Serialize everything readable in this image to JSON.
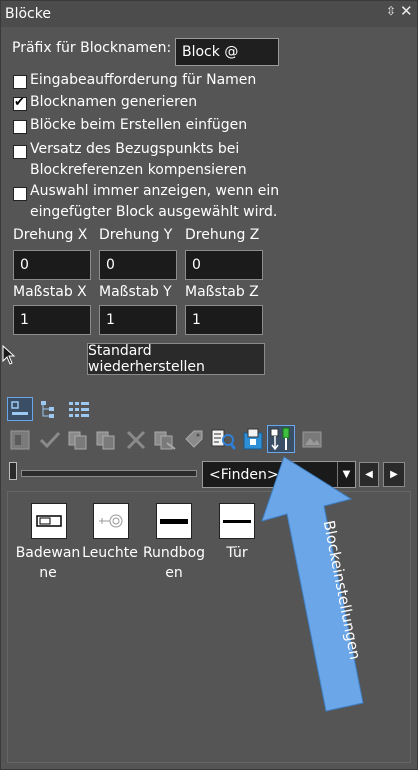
{
  "window": {
    "title": "Blöcke"
  },
  "prefix": {
    "label": "Präfix für Blocknamen:",
    "value": "Block @"
  },
  "options": [
    {
      "label": "Eingabeaufforderung für Namen",
      "checked": false
    },
    {
      "label": "Blocknamen generieren",
      "checked": true
    },
    {
      "label": "Blöcke beim Erstellen einfügen",
      "checked": false
    },
    {
      "label_line1": "Versatz des Bezugspunkts bei",
      "label_line2": "Blockreferenzen kompensieren",
      "checked": false
    },
    {
      "label_line1": "Auswahl immer anzeigen, wenn ein",
      "label_line2": "eingefügter Block ausgewählt wird.",
      "checked": false
    }
  ],
  "rotation": {
    "labels": [
      "Drehung X",
      "Drehung Y",
      "Drehung Z"
    ],
    "values": [
      "0",
      "0",
      "0"
    ]
  },
  "scale": {
    "labels": [
      "Maßstab X",
      "Maßstab Y",
      "Maßstab Z"
    ],
    "values": [
      "1",
      "1",
      "1"
    ]
  },
  "reset_button": "Standard wiederherstellen",
  "find": {
    "value": "<Finden>"
  },
  "blocks": [
    {
      "name_line1": "Badewan",
      "name_line2": "ne",
      "icon": "bathtub-icon"
    },
    {
      "name_line1": "Leuchte",
      "name_line2": "",
      "icon": "light-icon"
    },
    {
      "name_line1": "Rundbog",
      "name_line2": "en",
      "icon": "arch-icon"
    },
    {
      "name_line1": "Tür",
      "name_line2": "",
      "icon": "door-icon"
    }
  ],
  "callout": {
    "text": "Blockeinstellungen",
    "color": "#6aa6e8"
  },
  "colors": {
    "panel_bg": "#555555",
    "field_bg": "#1b1b1b",
    "accent": "#6aa6e8"
  }
}
